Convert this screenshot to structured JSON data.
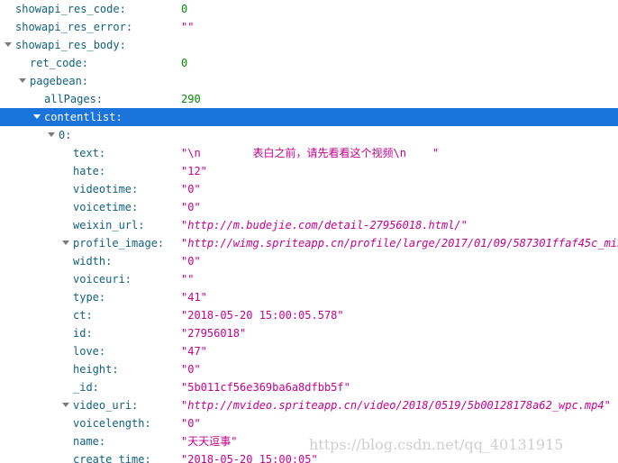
{
  "rows": [
    {
      "key": "showapi_res_code:",
      "value": "0"
    },
    {
      "key": "showapi_res_error:",
      "value": "\"\""
    },
    {
      "key": "showapi_res_body:",
      "value": ""
    },
    {
      "key": "ret_code:",
      "value": "0"
    },
    {
      "key": "pagebean:",
      "value": ""
    },
    {
      "key": "allPages:",
      "value": "290"
    },
    {
      "key": "contentlist:",
      "value": ""
    },
    {
      "key": "0:",
      "value": ""
    },
    {
      "key": "text:",
      "value": "\"\\n        表白之前，请先看看这个视频\\n    \""
    },
    {
      "key": "hate:",
      "value": "\"12\""
    },
    {
      "key": "videotime:",
      "value": "\"0\""
    },
    {
      "key": "voicetime:",
      "value": "\"0\""
    },
    {
      "key": "weixin_url:",
      "value": "\"http://m.budejie.com/detail-27956018.html/\""
    },
    {
      "key": "profile_image:",
      "value": "\"http://wimg.spriteapp.cn/profile/large/2017/01/09/587301ffaf45c_mini"
    },
    {
      "key": "width:",
      "value": "\"0\""
    },
    {
      "key": "voiceuri:",
      "value": "\"\""
    },
    {
      "key": "type:",
      "value": "\"41\""
    },
    {
      "key": "ct:",
      "value": "\"2018-05-20 15:00:05.578\""
    },
    {
      "key": "id:",
      "value": "\"27956018\""
    },
    {
      "key": "love:",
      "value": "\"47\""
    },
    {
      "key": "height:",
      "value": "\"0\""
    },
    {
      "key": "_id:",
      "value": "\"5b011cf56e369ba6a8dfbb5f\""
    },
    {
      "key": "video_uri:",
      "value": "\"http://mvideo.spriteapp.cn/video/2018/0519/5b00128178a62_wpc.mp4\""
    },
    {
      "key": "voicelength:",
      "value": "\"0\""
    },
    {
      "key": "name:",
      "value": "\"天天逗事\""
    },
    {
      "key": "create_time:",
      "value": "\"2018-05-20 15:00:05\""
    }
  ],
  "watermark": "https://blog.csdn.net/qq_40131915",
  "colors": {
    "key": "#12617f",
    "number": "#058b00",
    "string": "#c4008f",
    "selection": "#1a74db"
  }
}
